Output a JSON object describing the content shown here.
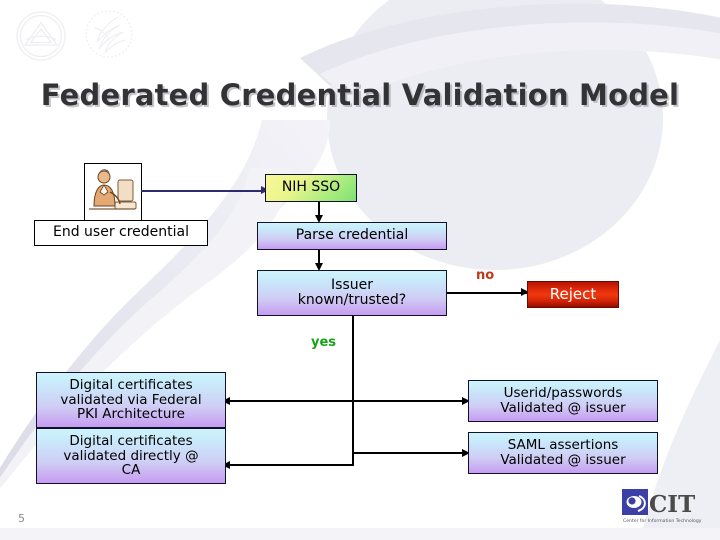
{
  "slide": {
    "title": "Federated Credential Validation Model",
    "page_number": "5",
    "watermarks": [
      {
        "name": "nih-logo-watermark",
        "label": "NATIONAL INSTITUTES OF HEALTH"
      },
      {
        "name": "hhs-logo-watermark",
        "label": "U.S. Department of Health and Human Services"
      }
    ]
  },
  "diagram": {
    "type": "flowchart",
    "nodes": [
      {
        "id": "end-user-credential",
        "label": "End user credential",
        "style": "plain-white"
      },
      {
        "id": "nih-sso",
        "label": "NIH SSO",
        "style": "yellow-green-gradient"
      },
      {
        "id": "parse-credential",
        "label": "Parse credential",
        "style": "blue-violet-gradient"
      },
      {
        "id": "issuer-known",
        "label": "Issuer\nknown/trusted?",
        "line1": "Issuer",
        "line2": "known/trusted?",
        "style": "blue-violet-gradient"
      },
      {
        "id": "reject",
        "label": "Reject",
        "style": "red-gradient"
      },
      {
        "id": "fed-pki",
        "line1": "Digital certificates",
        "line2": "validated via Federal",
        "line3": "PKI Architecture",
        "style": "blue-violet-gradient"
      },
      {
        "id": "direct-ca",
        "line1": "Digital certificates",
        "line2": "validated directly @",
        "line3": "CA",
        "style": "blue-violet-gradient"
      },
      {
        "id": "userid-passwords",
        "line1": "Userid/passwords",
        "line2": "Validated @ issuer",
        "style": "blue-violet-gradient"
      },
      {
        "id": "saml-assertions",
        "line1": "SAML assertions",
        "line2": "Validated @ issuer",
        "style": "blue-violet-gradient"
      }
    ],
    "edge_labels": {
      "no": "no",
      "yes": "yes"
    },
    "edges": [
      {
        "from": "end-user-credential",
        "to": "nih-sso",
        "label": ""
      },
      {
        "from": "nih-sso",
        "to": "parse-credential",
        "label": ""
      },
      {
        "from": "parse-credential",
        "to": "issuer-known",
        "label": ""
      },
      {
        "from": "issuer-known",
        "to": "reject",
        "label": "no"
      },
      {
        "from": "issuer-known",
        "to": "fed-pki",
        "label": "yes"
      },
      {
        "from": "issuer-known",
        "to": "direct-ca",
        "label": "yes"
      },
      {
        "from": "issuer-known",
        "to": "userid-passwords",
        "label": "yes"
      },
      {
        "from": "issuer-known",
        "to": "saml-assertions",
        "label": "yes"
      }
    ],
    "colors": {
      "no_label": "#c0391b",
      "yes_label": "#17a317",
      "reject_fill": "#e2290a",
      "sso_fill": "#a9ec7e",
      "process_fill": "#cfcdf4",
      "connector": "#000000",
      "user_connector": "#2c2c6e"
    }
  },
  "footer": {
    "logo_name": "cit-logo",
    "logo_initials": "CIT",
    "logo_tagline": "Center for Information Technology"
  }
}
